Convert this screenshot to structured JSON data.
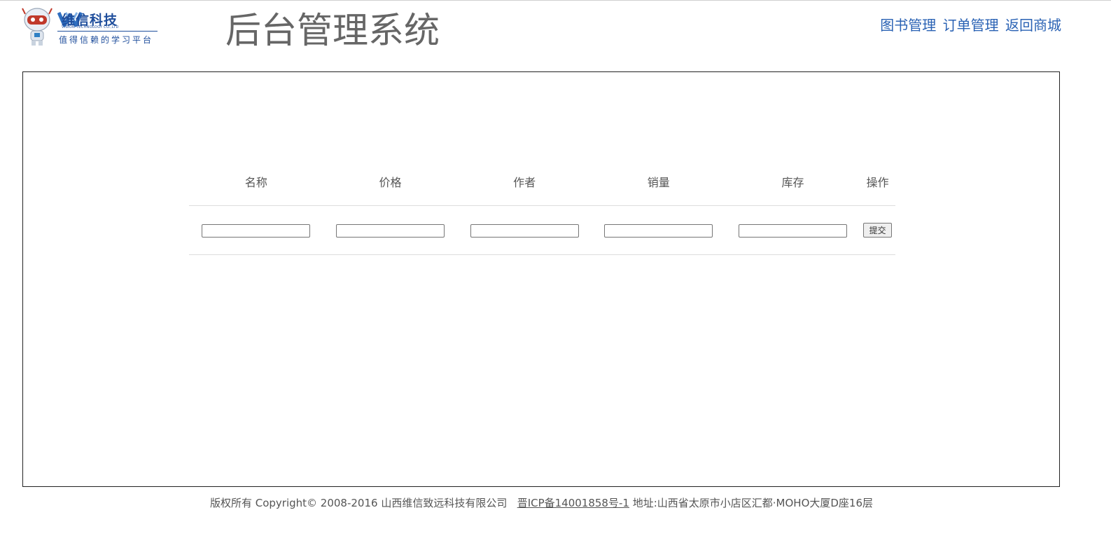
{
  "logo": {
    "brand_name": "维信科技",
    "brand_sub": "VISION TECHNOLOGY CO.,LTD",
    "slogan": "值得信赖的学习平台",
    "brand_color": "#1f4e9c"
  },
  "header": {
    "title": "后台管理系统"
  },
  "nav": {
    "items": [
      {
        "label": "图书管理"
      },
      {
        "label": "订单管理"
      },
      {
        "label": "返回商城"
      }
    ],
    "link_color": "#2a62b4"
  },
  "form": {
    "columns": [
      "名称",
      "价格",
      "作者",
      "销量",
      "库存",
      "操作"
    ],
    "inputs": {
      "name": "",
      "price": "",
      "author": "",
      "sales": "",
      "stock": ""
    },
    "submit_label": "提交"
  },
  "footer": {
    "copyright": "版权所有 Copyright© 2008-2016 山西维信致远科技有限公司",
    "icp": "晋ICP备14001858号-1",
    "address": "地址:山西省太原市小店区汇都·MOHO大厦D座16层"
  }
}
